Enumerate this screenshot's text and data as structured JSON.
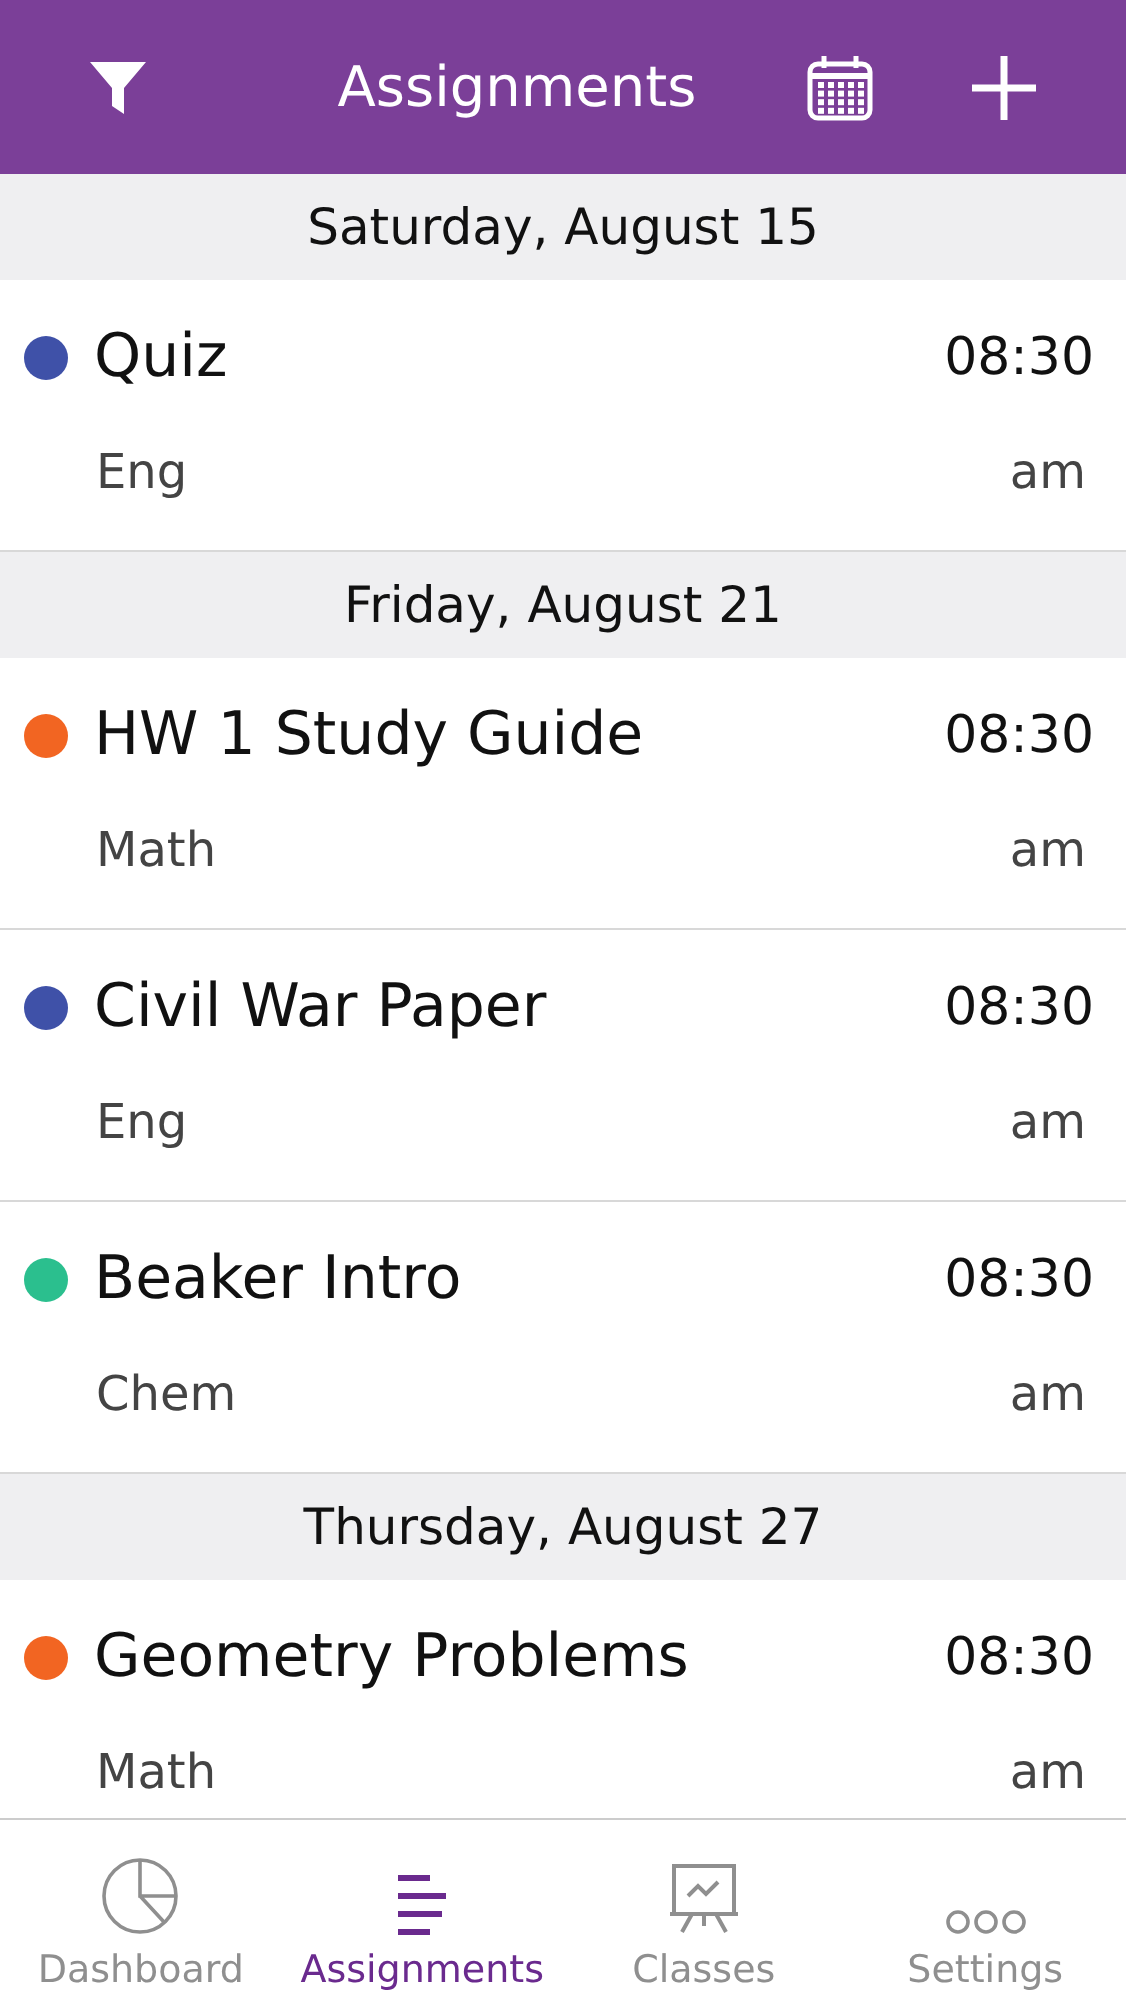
{
  "header": {
    "title": "Assignments"
  },
  "sections": [
    {
      "date": "Saturday, August 15",
      "items": [
        {
          "title": "Quiz",
          "class": "Eng",
          "time": "08:30",
          "period": "am",
          "color": "#3f51a8"
        }
      ]
    },
    {
      "date": "Friday, August 21",
      "items": [
        {
          "title": "HW 1 Study Guide",
          "class": "Math",
          "time": "08:30",
          "period": "am",
          "color": "#f26522"
        },
        {
          "title": "Civil War Paper",
          "class": "Eng",
          "time": "08:30",
          "period": "am",
          "color": "#3f51a8"
        },
        {
          "title": "Beaker Intro",
          "class": "Chem",
          "time": "08:30",
          "period": "am",
          "color": "#2bbf8e"
        }
      ]
    },
    {
      "date": "Thursday, August 27",
      "items": [
        {
          "title": "Geometry Problems",
          "class": "Math",
          "time": "08:30",
          "period": "am",
          "color": "#f26522"
        }
      ]
    }
  ],
  "tabs": [
    {
      "label": "Dashboard",
      "kind": "dashboard",
      "selected": false
    },
    {
      "label": "Assignments",
      "kind": "assignments",
      "selected": true
    },
    {
      "label": "Classes",
      "kind": "classes",
      "selected": false
    },
    {
      "label": "Settings",
      "kind": "settings",
      "selected": false
    }
  ]
}
